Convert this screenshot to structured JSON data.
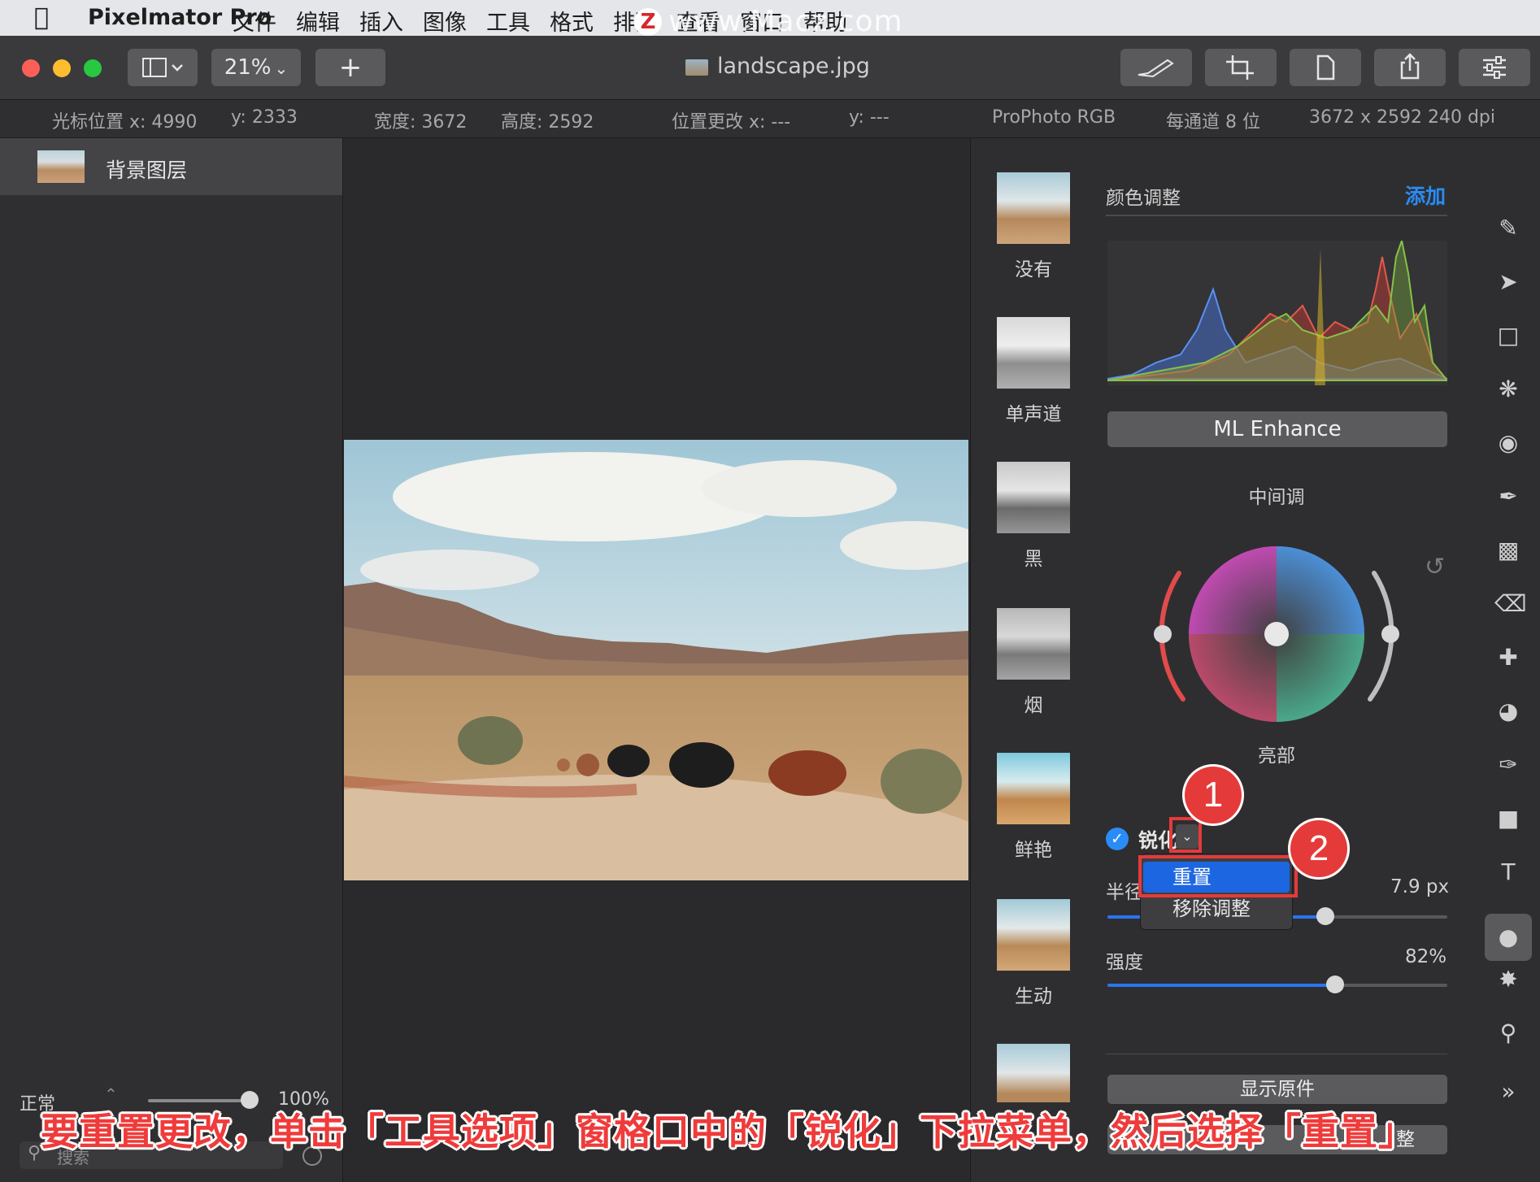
{
  "menubar": {
    "app_name": "Pixelmator Pro",
    "items": [
      "文件",
      "编辑",
      "插入",
      "图像",
      "工具",
      "格式",
      "排列",
      "查看",
      "窗口",
      "帮助"
    ],
    "watermark": "www.Macz.com",
    "watermark_logo": "Z"
  },
  "toolbar": {
    "zoom": "21%",
    "add_label": "+",
    "document_title": "landscape.jpg"
  },
  "infobar": {
    "cursor_x": "光标位置 x: 4990",
    "cursor_y": "y: 2333",
    "width": "宽度: 3672",
    "height": "高度: 2592",
    "pos_change_x": "位置更改 x: ---",
    "pos_change_y": "y: ---",
    "color_profile": "ProPhoto RGB",
    "bit_depth": "每通道 8 位",
    "dimensions": "3672 x 2592 240 dpi"
  },
  "layers": {
    "items": [
      {
        "name": "背景图层"
      }
    ],
    "blend_mode": "正常",
    "opacity": "100%",
    "search_placeholder": "搜索"
  },
  "presets": [
    {
      "label": "没有",
      "style": "color"
    },
    {
      "label": "单声道",
      "style": "mono"
    },
    {
      "label": "黑",
      "style": "mono"
    },
    {
      "label": "烟",
      "style": "mono"
    },
    {
      "label": "鲜艳",
      "style": "color"
    },
    {
      "label": "生动",
      "style": "color"
    }
  ],
  "adjust": {
    "section_title": "颜色调整",
    "add_label": "添加",
    "ml_enhance": "ML Enhance",
    "midtones_label": "中间调",
    "highlights_label": "亮部",
    "sharpen": {
      "label": "锐化",
      "dropdown_chevron": "⌄",
      "radius_label": "半径",
      "radius_value": "7.9 px",
      "radius_fraction": 0.64,
      "strength_label": "强度",
      "strength_value": "82%",
      "strength_fraction": 0.67
    },
    "show_original": "显示原件",
    "bottom_button": "整"
  },
  "dropdown_menu": {
    "reset": "重置",
    "remove": "移除调整"
  },
  "annotations": {
    "step1": "1",
    "step2": "2",
    "caption": "要重置更改，单击「工具选项」窗格口中的「锐化」下拉菜单，然后选择「重置」"
  },
  "colors": {
    "accent_blue": "#2a8cf6",
    "highlight_red": "#e53a3a"
  },
  "icons": [
    "apple-icon",
    "sidebar-icon",
    "chevron-down-icon",
    "brush-icon",
    "crop-icon",
    "page-icon",
    "share-icon",
    "sliders-icon",
    "reset-icon",
    "search-icon",
    "filter-icon"
  ]
}
